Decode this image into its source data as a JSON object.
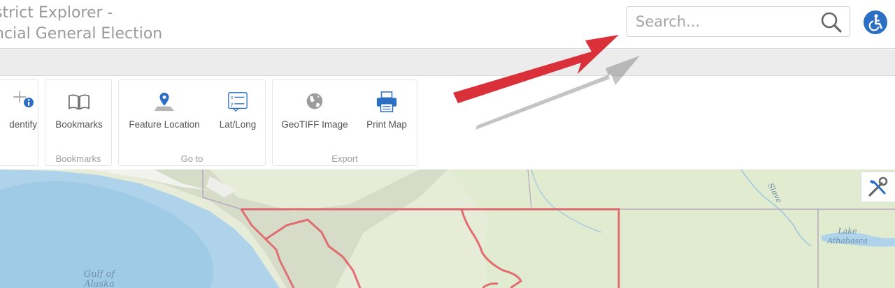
{
  "header": {
    "title_line1": "strict Explorer -",
    "title_line2": "ncial General Election",
    "search_placeholder": "Search...",
    "accessibility_icon": "wheelchair-icon"
  },
  "ribbon": {
    "groups": [
      {
        "label": "",
        "tools": [
          {
            "label": "dentify",
            "icon": "identify-icon"
          }
        ]
      },
      {
        "label": "Bookmarks",
        "tools": [
          {
            "label": "Bookmarks",
            "icon": "book-icon"
          }
        ]
      },
      {
        "label": "Go to",
        "tools": [
          {
            "label": "Feature Location",
            "icon": "map-pin-icon"
          },
          {
            "label": "Lat/Long",
            "icon": "coordinates-icon"
          }
        ]
      },
      {
        "label": "Export",
        "tools": [
          {
            "label": "GeoTIFF Image",
            "icon": "globe-icon"
          },
          {
            "label": "Print Map",
            "icon": "printer-icon"
          }
        ]
      }
    ]
  },
  "map": {
    "labels": {
      "gulf_line1": "Gulf of",
      "gulf_line2": "Alaska",
      "lake_line1": "Lake",
      "lake_line2": "Athabasca",
      "river": "Slave"
    },
    "tools_icon": "wrench-screwdriver-icon"
  },
  "colors": {
    "accent": "#2a6fc3",
    "annotation_arrow": "#d9303a",
    "district_boundary": "#e0585f"
  }
}
